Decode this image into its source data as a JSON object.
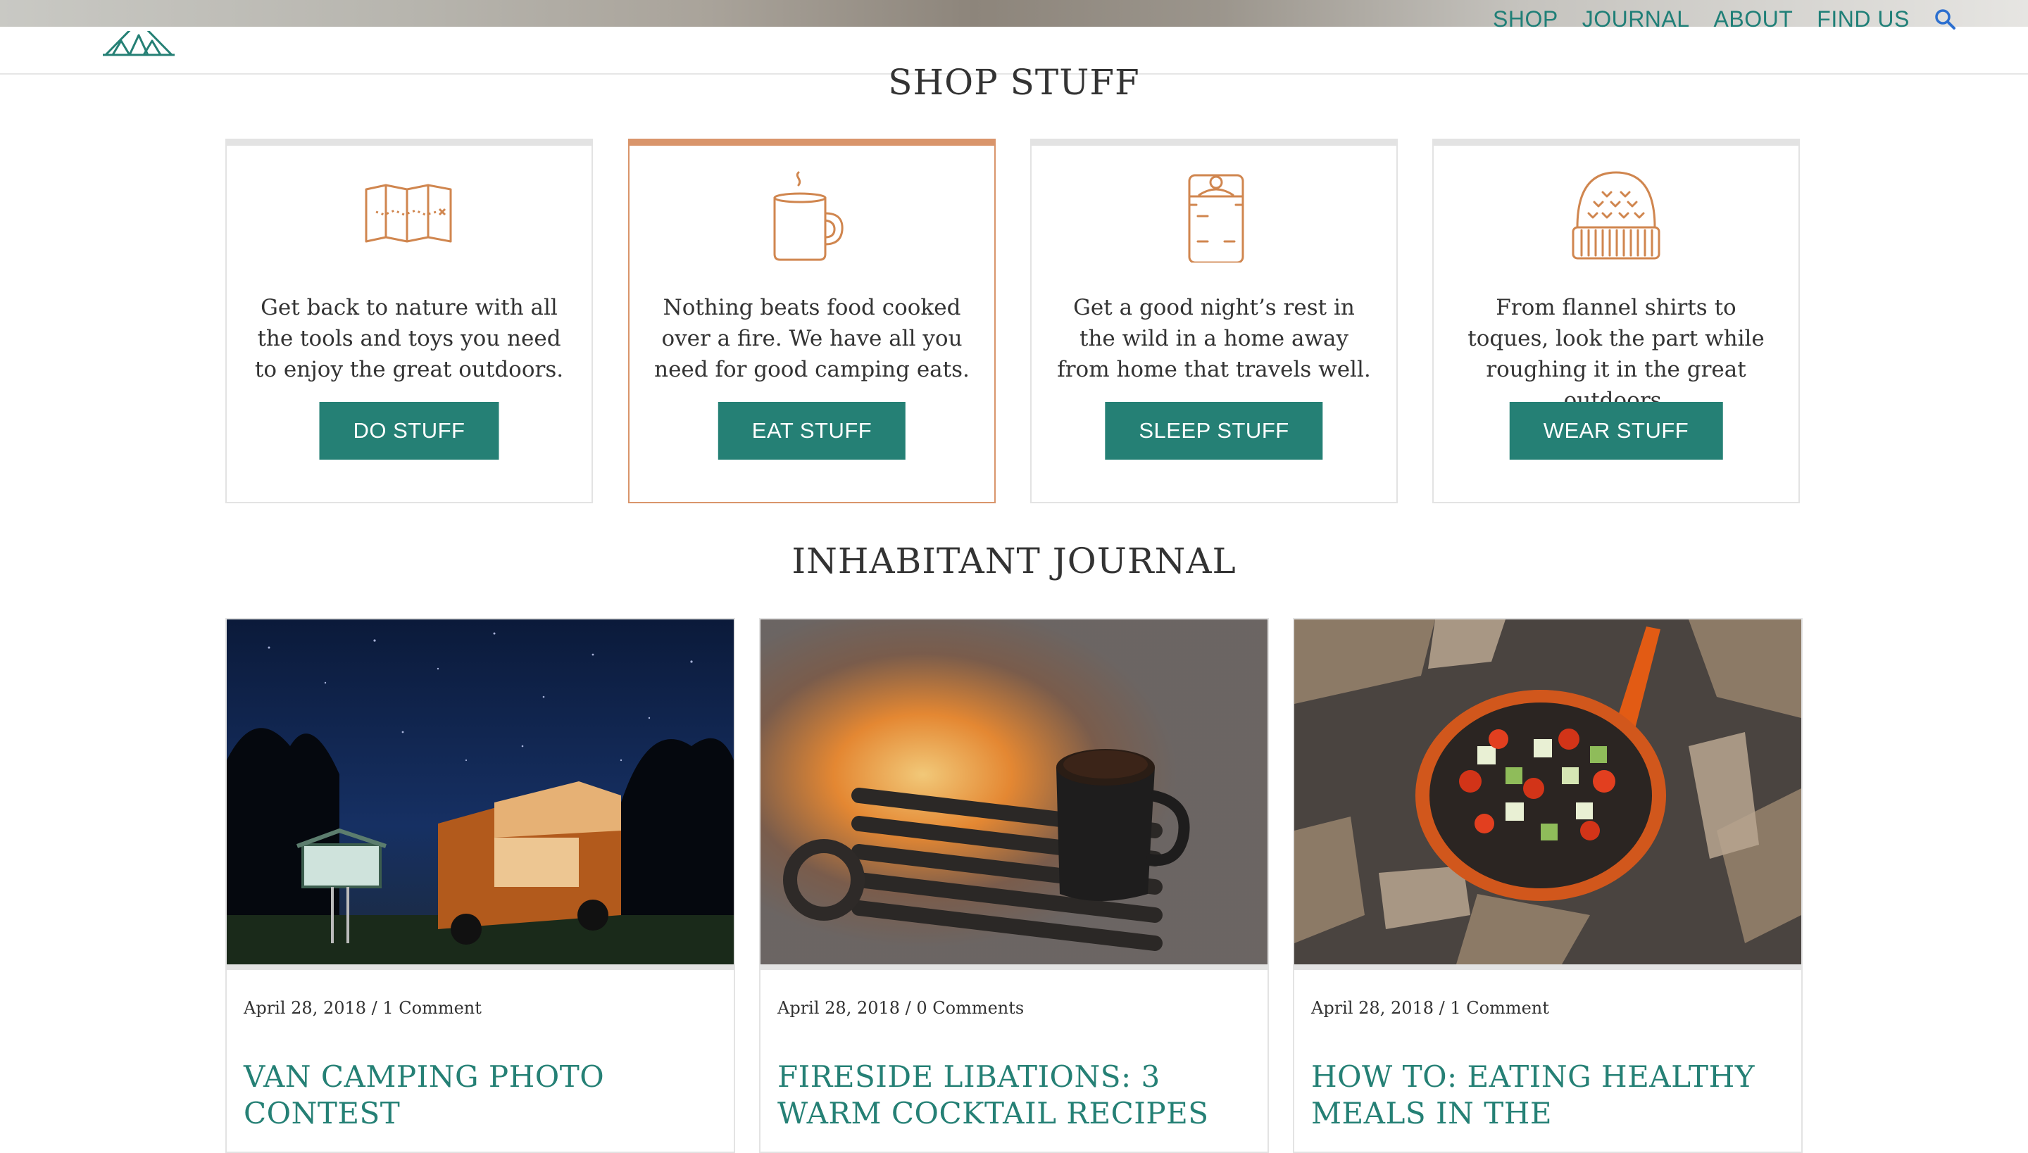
{
  "nav": {
    "items": [
      "SHOP",
      "JOURNAL",
      "ABOUT",
      "FIND US"
    ],
    "search_icon": "search-icon"
  },
  "colors": {
    "accent": "#258075",
    "nav_text": "#1f7f77",
    "card_active_border": "#d9956b",
    "icon_stroke": "#d0864f"
  },
  "shop": {
    "title": "SHOP STUFF",
    "cards": [
      {
        "icon": "map-icon",
        "description": "Get back to nature with all the tools and toys you need to enjoy the great outdoors.",
        "button": "DO STUFF"
      },
      {
        "icon": "mug-icon",
        "description": "Nothing beats food cooked over a fire. We have all you need for good camping eats.",
        "button": "EAT STUFF"
      },
      {
        "icon": "sleeping-bag-icon",
        "description": "Get a good night’s rest in the wild in a home away from home that travels well.",
        "button": "SLEEP STUFF"
      },
      {
        "icon": "toque-icon",
        "description": "From flannel shirts to toques, look the part while roughing it in the great outdoors.",
        "button": "WEAR STUFF"
      }
    ]
  },
  "journal": {
    "title": "INHABITANT JOURNAL",
    "posts": [
      {
        "meta": "April 28, 2018 / 1 Comment",
        "title": "VAN CAMPING PHOTO CONTEST"
      },
      {
        "meta": "April 28, 2018 / 0 Comments",
        "title": "FIRESIDE LIBATIONS: 3 WARM COCKTAIL RECIPES"
      },
      {
        "meta": "April 28, 2018 / 1 Comment",
        "title": "HOW TO: EATING HEALTHY MEALS IN THE"
      }
    ]
  }
}
